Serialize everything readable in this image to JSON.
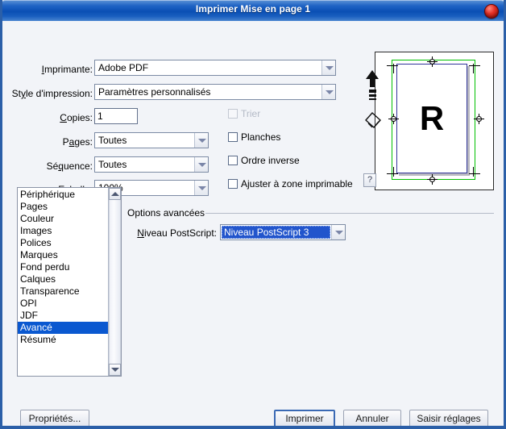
{
  "window": {
    "title": "Imprimer Mise en page 1",
    "close_icon": "close-icon",
    "accent_blue": "#0a4fb4",
    "close_red": "#e53228"
  },
  "form": {
    "printer": {
      "label": "Imprimante:",
      "value": "Adobe PDF"
    },
    "print_style": {
      "label": "Style d'impression:",
      "value": "Paramètres personnalisés"
    },
    "copies": {
      "label": "Copies:",
      "value": "1"
    },
    "pages": {
      "label": "Pages:",
      "value": "Toutes"
    },
    "sequence": {
      "label": "Séquence:",
      "value": "Toutes"
    },
    "scale": {
      "label": "Echelle:",
      "value": "100%"
    }
  },
  "checkboxes": [
    {
      "name": "collate",
      "label": "Trier",
      "checked": false,
      "disabled": true
    },
    {
      "name": "spreads",
      "label": "Planches",
      "checked": false,
      "disabled": false
    },
    {
      "name": "reverse-order",
      "label": "Ordre inverse",
      "checked": false,
      "disabled": false
    },
    {
      "name": "fit-printable-area",
      "label": "Ajuster à zone imprimable",
      "checked": false,
      "disabled": false
    }
  ],
  "category_list": {
    "items": [
      "Périphérique",
      "Pages",
      "Couleur",
      "Images",
      "Polices",
      "Marques",
      "Fond perdu",
      "Calques",
      "Transparence",
      "OPI",
      "JDF",
      "Avancé",
      "Résumé"
    ],
    "selected": "Avancé",
    "selected_index": 11,
    "selection_color": "#0a58d0"
  },
  "advanced": {
    "group_title": "Options avancées",
    "postscript_level": {
      "label": "Niveau PostScript:",
      "value": "Niveau PostScript 3",
      "highlight_color": "#2255cc"
    }
  },
  "preview": {
    "page_letter": "R",
    "bleed_color": "#00c000",
    "page_border_color": "#33369b",
    "orientation_icon": "up-arrow-icon",
    "rotate_icon": "diamond-page-icon",
    "help_label": "?"
  },
  "buttons": {
    "properties": "Propriétés...",
    "print": "Imprimer",
    "cancel": "Annuler",
    "save_preset": "Saisir réglages"
  }
}
